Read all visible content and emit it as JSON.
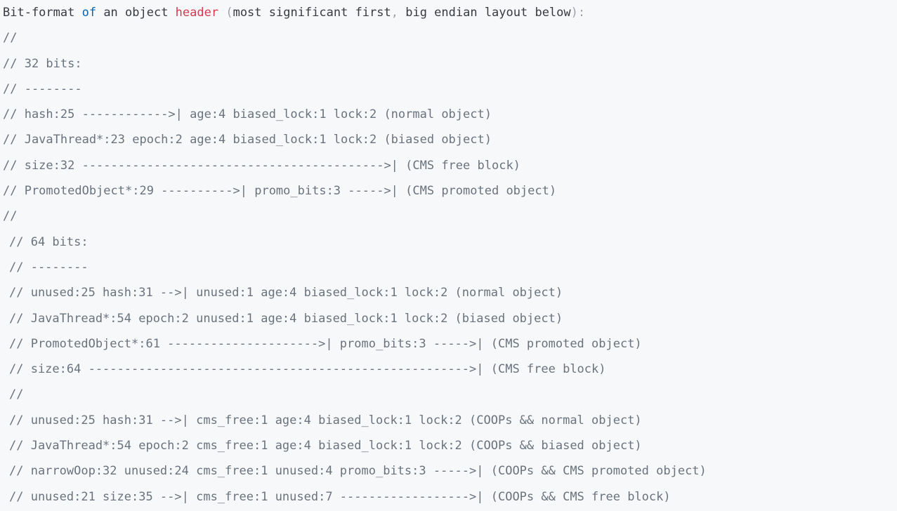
{
  "header": {
    "t1": "Bit-format ",
    "kw_of": "of",
    "t2": " an object ",
    "kw_header": "header",
    "p_open": " (",
    "t3": "most significant first",
    "comma": ",",
    "t4": " big endian layout below",
    "p_close": "):"
  },
  "lines": [
    "//",
    "// 32 bits:",
    "// --------",
    "// hash:25 ------------>| age:4 biased_lock:1 lock:2 (normal object)",
    "// JavaThread*:23 epoch:2 age:4 biased_lock:1 lock:2 (biased object)",
    "// size:32 ------------------------------------------>| (CMS free block)",
    "// PromotedObject*:29 ---------->| promo_bits:3 ----->| (CMS promoted object)",
    "//",
    "// 64 bits:",
    "// --------",
    "// unused:25 hash:31 -->| unused:1 age:4 biased_lock:1 lock:2 (normal object)",
    "// JavaThread*:54 epoch:2 unused:1 age:4 biased_lock:1 lock:2 (biased object)",
    "// PromotedObject*:61 --------------------->| promo_bits:3 ----->| (CMS promoted object)",
    "// size:64 ----------------------------------------------------->| (CMS free block)",
    "//",
    "// unused:25 hash:31 -->| cms_free:1 age:4 biased_lock:1 lock:2 (COOPs && normal object)",
    "// JavaThread*:54 epoch:2 cms_free:1 age:4 biased_lock:1 lock:2 (COOPs && biased object)",
    "// narrowOop:32 unused:24 cms_free:1 unused:4 promo_bits:3 ----->| (COOPs && CMS promoted object)",
    "// unused:21 size:35 -->| cms_free:1 unused:7 ------------------>| (COOPs && CMS free block)"
  ]
}
